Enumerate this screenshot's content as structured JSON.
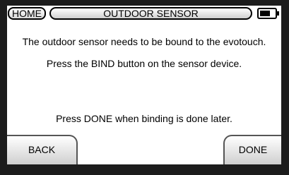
{
  "header": {
    "home_label": "HOME",
    "title": "OUTDOOR SENSOR",
    "battery_icon": "battery-icon"
  },
  "messages": {
    "line1": "The outdoor sensor needs to be bound to the evotouch.",
    "line2": "Press the BIND button on the sensor device.",
    "line3": "Press DONE when binding is done later."
  },
  "footer": {
    "back_label": "BACK",
    "done_label": "DONE"
  }
}
